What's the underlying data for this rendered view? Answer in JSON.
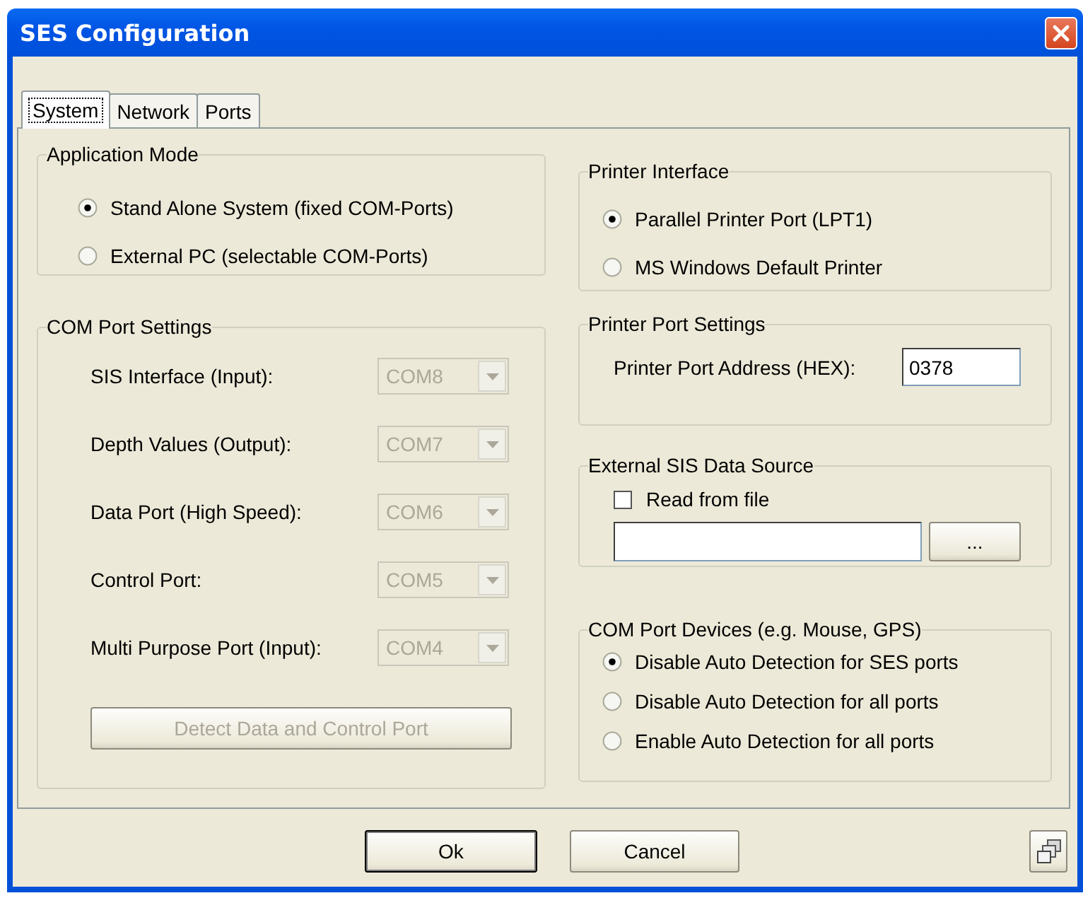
{
  "window": {
    "title": "SES Configuration"
  },
  "tabs": [
    {
      "label": "System",
      "selected": true
    },
    {
      "label": "Network",
      "selected": false
    },
    {
      "label": "Ports",
      "selected": false
    }
  ],
  "application_mode": {
    "title": "Application Mode",
    "options": [
      {
        "label": "Stand Alone System (fixed COM-Ports)",
        "selected": true
      },
      {
        "label": "External PC (selectable COM-Ports)",
        "selected": false
      }
    ]
  },
  "com_port_settings": {
    "title": "COM Port Settings",
    "ports": [
      {
        "label": "SIS Interface (Input):",
        "value": "COM8",
        "disabled": true
      },
      {
        "label": "Depth Values (Output):",
        "value": "COM7",
        "disabled": true
      },
      {
        "label": "Data Port (High Speed):",
        "value": "COM6",
        "disabled": true
      },
      {
        "label": "Control Port:",
        "value": "COM5",
        "disabled": true
      },
      {
        "label": "Multi Purpose Port (Input):",
        "value": "COM4",
        "disabled": true
      }
    ],
    "detect_button": {
      "label": "Detect Data and Control Port",
      "disabled": true
    }
  },
  "printer_interface": {
    "title": "Printer Interface",
    "options": [
      {
        "label": "Parallel Printer Port (LPT1)",
        "selected": true
      },
      {
        "label": "MS Windows Default Printer",
        "selected": false
      }
    ]
  },
  "printer_port_settings": {
    "title": "Printer Port Settings",
    "label": "Printer Port Address (HEX):",
    "value": "0378"
  },
  "external_sis_data_source": {
    "title": "External SIS Data Source",
    "checkbox": {
      "label": "Read from file",
      "checked": false
    },
    "browse_button": "..."
  },
  "com_port_devices": {
    "title": "COM Port Devices (e.g. Mouse, GPS)",
    "options": [
      {
        "label": "Disable Auto Detection for SES ports",
        "selected": true
      },
      {
        "label": "Disable Auto Detection for all ports",
        "selected": false
      },
      {
        "label": "Enable Auto Detection for all ports",
        "selected": false
      }
    ]
  },
  "buttons": [
    {
      "label": "Ok",
      "default": true
    },
    {
      "label": "Cancel",
      "default": false
    }
  ]
}
